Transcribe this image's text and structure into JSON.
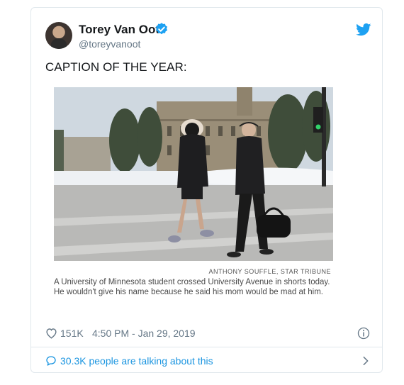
{
  "tweet": {
    "author_name": "Torey Van Oot",
    "author_handle": "@toreyvanoot",
    "text": "CAPTION OF THE YEAR:",
    "photo_credit": "ANTHONY SOUFFLE, STAR TRIBUNE",
    "photo_caption": "A University of Minnesota student crossed University Avenue in shorts today. He wouldn't give his name because he said his mom would be mad at him.",
    "likes": "151K",
    "timestamp": "4:50 PM - Jan 29, 2019",
    "talking": "30.3K people are talking about this"
  },
  "icons": {
    "verified": "verified-badge-icon",
    "brand": "twitter-bird-icon",
    "like": "heart-icon",
    "info": "info-icon",
    "reply": "speech-bubble-icon",
    "next": "chevron-right-icon"
  },
  "colors": {
    "accent": "#1da1f2",
    "link": "#1b95e0",
    "text": "#14171a",
    "muted": "#657786",
    "border": "#e1e8ed"
  }
}
